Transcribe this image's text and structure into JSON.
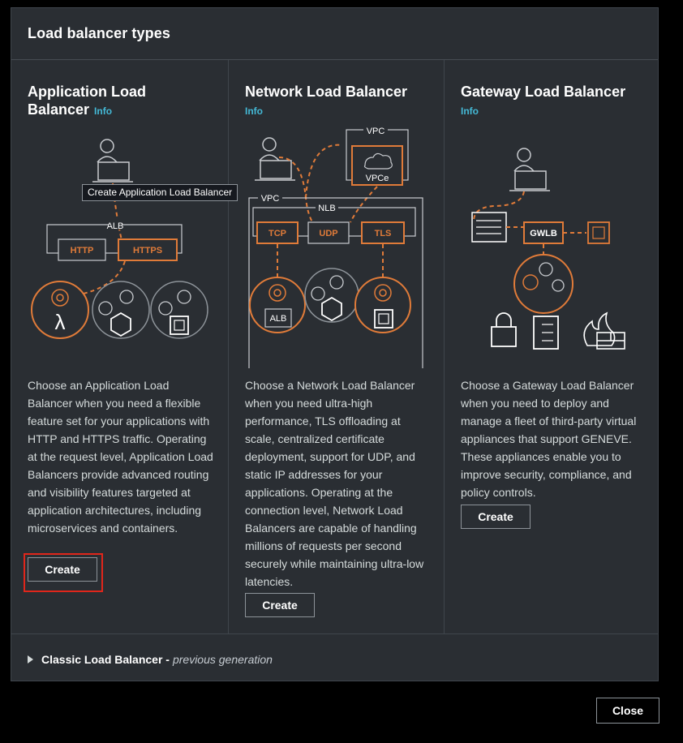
{
  "modal": {
    "title": "Load balancer types",
    "cards": [
      {
        "title": "Application Load Balancer",
        "info": "Info",
        "description": "Choose an Application Load Balancer when you need a flexible feature set for your applications with HTTP and HTTPS traffic. Operating at the request level, Application Load Balancers provide advanced routing and visibility features targeted at application architectures, including microservices and containers.",
        "create_label": "Create",
        "diagram": {
          "group": "ALB",
          "listeners": [
            "HTTP",
            "HTTPS"
          ]
        }
      },
      {
        "title": "Network Load Balancer",
        "info": "Info",
        "description": "Choose a Network Load Balancer when you need ultra-high performance, TLS offloading at scale, centralized certificate deployment, support for UDP, and static IP addresses for your applications. Operating at the connection level, Network Load Balancers are capable of handling millions of requests per second securely while maintaining ultra-low latencies.",
        "create_label": "Create",
        "diagram": {
          "vpc_top": "VPC",
          "endpoint": "VPCe",
          "vpc": "VPC",
          "group": "NLB",
          "listeners": [
            "TCP",
            "UDP",
            "TLS"
          ],
          "target": "ALB"
        }
      },
      {
        "title": "Gateway Load Balancer",
        "info": "Info",
        "description": "Choose a Gateway Load Balancer when you need to deploy and manage a fleet of third-party virtual appliances that support GENEVE. These appliances enable you to improve security, compliance, and policy controls.",
        "create_label": "Create",
        "diagram": {
          "group": "GWLB"
        }
      }
    ],
    "tooltip": "Create Application Load Balancer",
    "classic": {
      "label": "Classic Load Balancer -",
      "sub": "previous generation"
    }
  },
  "footer": {
    "close_label": "Close"
  },
  "colors": {
    "accent": "#e07b39",
    "info": "#44b9d6",
    "highlight": "#e0261b",
    "panel": "#2a2e33"
  }
}
